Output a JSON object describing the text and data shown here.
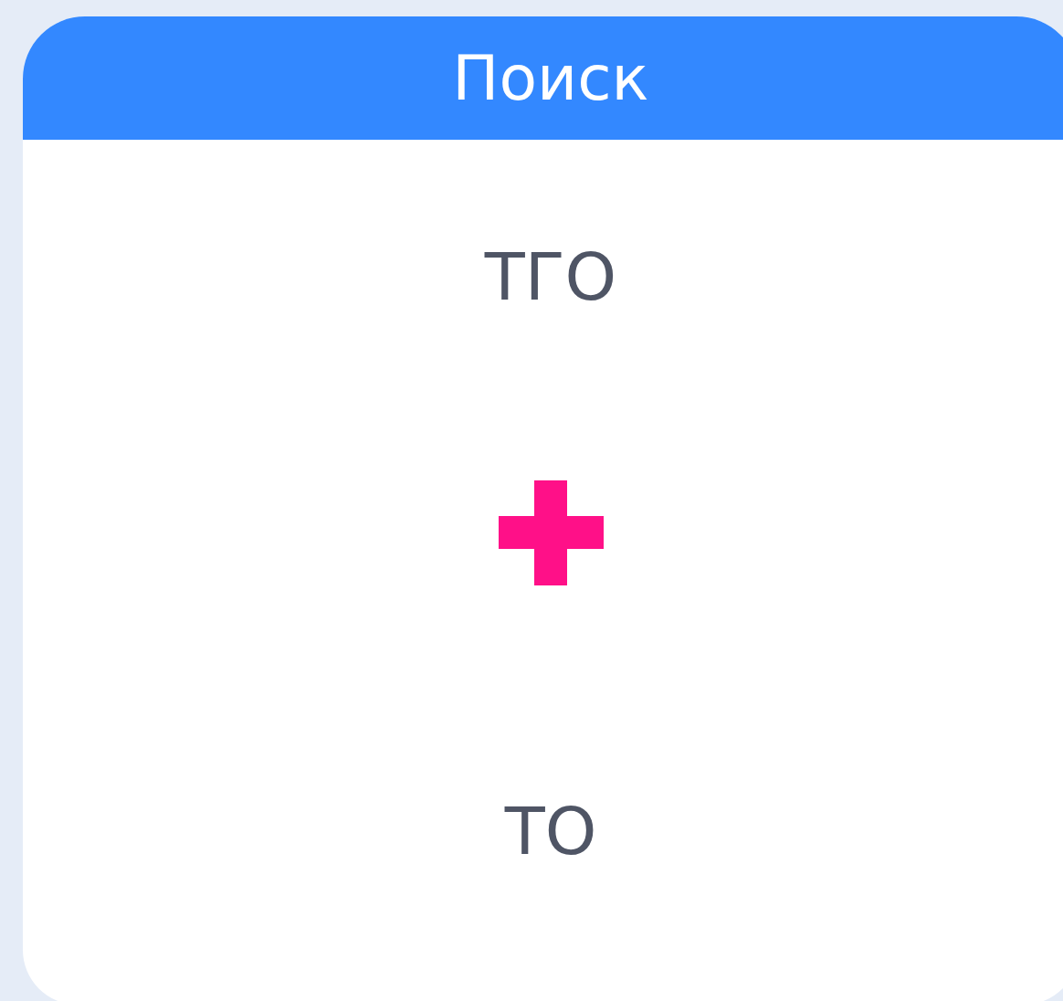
{
  "header": {
    "title": "Поиск"
  },
  "cards": [
    {
      "text": "ТГО"
    },
    {
      "text": "ТО"
    }
  ]
}
